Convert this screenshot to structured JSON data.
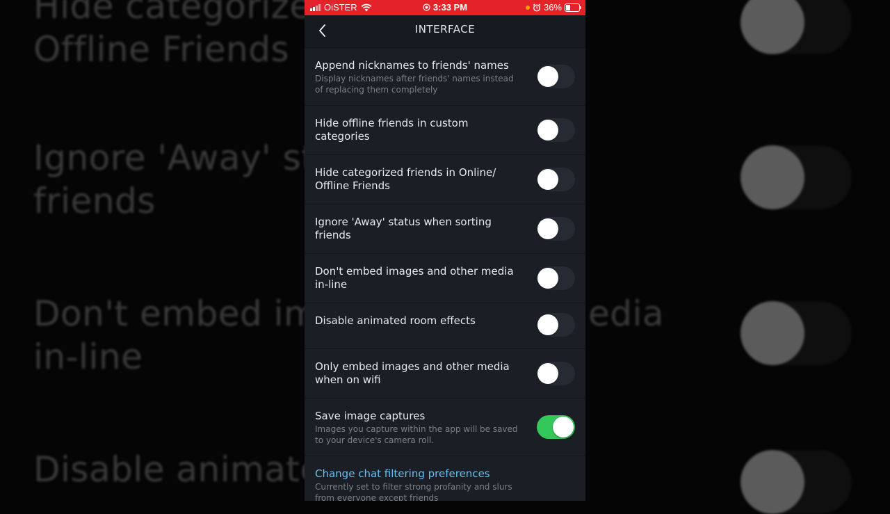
{
  "background_text": {
    "top": "Hide categorized\nOffline Friends",
    "ignore": "Ignore 'Away' sta\nfriends",
    "embed": "Don't embed ima\nin-line",
    "embed_right": "edia",
    "animated": "Disable animated"
  },
  "status_bar": {
    "carrier": "OiSTER",
    "time": "3:33 PM",
    "battery": "36%",
    "color": "#e3222a"
  },
  "nav": {
    "title": "INTERFACE",
    "back_icon": "chevron-left-icon"
  },
  "settings": [
    {
      "label": "Append nicknames to friends' names",
      "description": "Display nicknames after friends' names instead of replacing them completely",
      "enabled": false
    },
    {
      "label": "Hide offline friends in custom categories",
      "description": "",
      "enabled": false
    },
    {
      "label": "Hide categorized friends in Online/ Offline Friends",
      "description": "",
      "enabled": false
    },
    {
      "label": "Ignore 'Away' status when sorting friends",
      "description": "",
      "enabled": false
    },
    {
      "label": "Don't embed images and other media in-line",
      "description": "",
      "enabled": false
    },
    {
      "label": "Disable animated room effects",
      "description": "",
      "enabled": false
    },
    {
      "label": "Only embed images and other media when on wifi",
      "description": "",
      "enabled": false
    },
    {
      "label": "Save image captures",
      "description": "Images you capture within the app will be saved to your device's camera roll.",
      "enabled": true
    }
  ],
  "chat_filter": {
    "label": "Change chat filtering preferences",
    "description": "Currently set to filter strong profanity and slurs from everyone except friends"
  },
  "colors": {
    "toggle_on": "#34c759",
    "toggle_off": "#262a33",
    "link": "#66c0f4",
    "panel": "#1b1e25"
  }
}
